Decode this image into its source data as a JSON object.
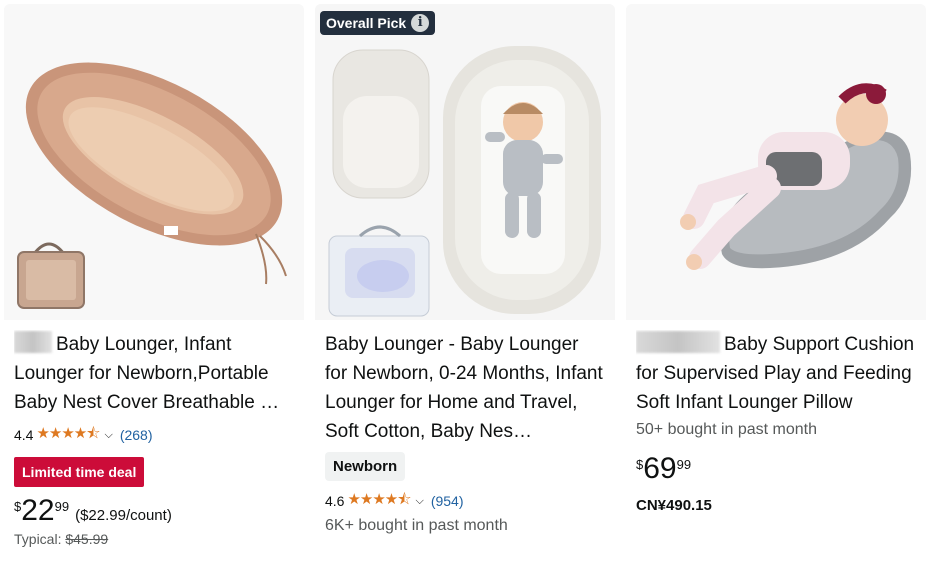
{
  "products": [
    {
      "title": "Baby Lounger, Infant Lounger for Newborn,Portable Baby Nest Cover Breathable …",
      "image": "beige-baby-nest-with-carry-bag",
      "rating": "4.4",
      "stars_out_of_5": 4.4,
      "review_count": "(268)",
      "deal_label": "Limited time deal",
      "price_symbol": "$",
      "price_whole": "22",
      "price_fraction": "99",
      "unit_price": "($22.99/count)",
      "typical_label": "Typical:",
      "typical_price": "$45.99"
    },
    {
      "badge": "Overall Pick",
      "title": "Baby Lounger - Baby Lounger for Newborn, 0-24 Months, Infant Lounger for Home and Travel, Soft Cotton, Baby Nes…",
      "image": "white-baby-lounger-with-baby",
      "chip": "Newborn",
      "rating": "4.6",
      "stars_out_of_5": 4.6,
      "review_count": "(954)",
      "bought": "6K+ bought in past month"
    },
    {
      "title": "Baby Support Cushion for Supervised Play and Feeding Soft Infant Lounger Pillow",
      "image": "baby-on-gray-support-cushion",
      "bought": "50+ bought in past month",
      "price_symbol": "$",
      "price_whole": "69",
      "price_fraction": "99",
      "alt_price": "CN¥490.15"
    }
  ],
  "colors": {
    "star": "#de7921",
    "link": "#2162a1",
    "deal": "#cc0c39",
    "badge": "#232f3e"
  }
}
